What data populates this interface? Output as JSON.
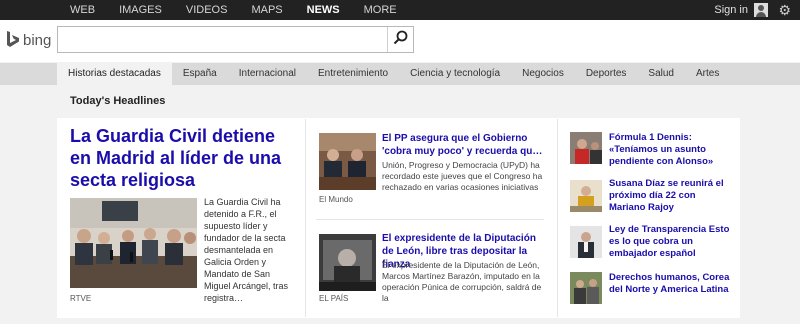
{
  "topnav": {
    "items": [
      "WEB",
      "IMAGES",
      "VIDEOS",
      "MAPS",
      "NEWS",
      "MORE"
    ],
    "active": "NEWS",
    "signin_label": "Sign in"
  },
  "header": {
    "logo_text": "bing",
    "search_value": "",
    "search_placeholder": ""
  },
  "categories": {
    "items": [
      "Historias destacadas",
      "España",
      "Internacional",
      "Entretenimiento",
      "Ciencia y tecnología",
      "Negocios",
      "Deportes",
      "Salud",
      "Artes"
    ],
    "active": "Historias destacadas"
  },
  "section_title": "Today's Headlines",
  "lead": {
    "title": "La Guardia Civil detiene en Madrid al líder de una secta religiosa",
    "snippet": "La Guardia Civil ha detenido a F.R., el supuesto líder y fundador de la secta desmantelada en Galicia Orden y Mandato de San Miguel Arcángel, tras registra…",
    "source": "RTVE"
  },
  "middle": [
    {
      "title": "El PP asegura que el Gobierno 'cobra muy poco' y recuerda qu…",
      "snippet": "Unión, Progreso y Democracia (UPyD) ha recordado este jueves que el Congreso ha rechazado en varias ocasiones iniciativas",
      "source": "El Mundo"
    },
    {
      "title": "El expresidente de la Diputación de León, libre tras depositar la fianza",
      "snippet": "El expresidente de la Diputación de León, Marcos Martínez Barazón, imputado en la operación Púnica de corrupción, saldrá de la",
      "source": "EL PAÍS"
    }
  ],
  "side": [
    {
      "title": "Fórmula 1 Dennis: «Teníamos un asunto pendiente con Alonso»"
    },
    {
      "title": "Susana Díaz se reunirá el próximo día 22 con Mariano Rajoy"
    },
    {
      "title": "Ley de Transparencia Esto es lo que cobra un embajador español"
    },
    {
      "title": "Derechos humanos, Corea del Norte y America Latina"
    }
  ],
  "colors": {
    "link": "#1a0dab",
    "topbar": "#222222",
    "catbar": "#dadada",
    "background": "#f2f2f2"
  }
}
